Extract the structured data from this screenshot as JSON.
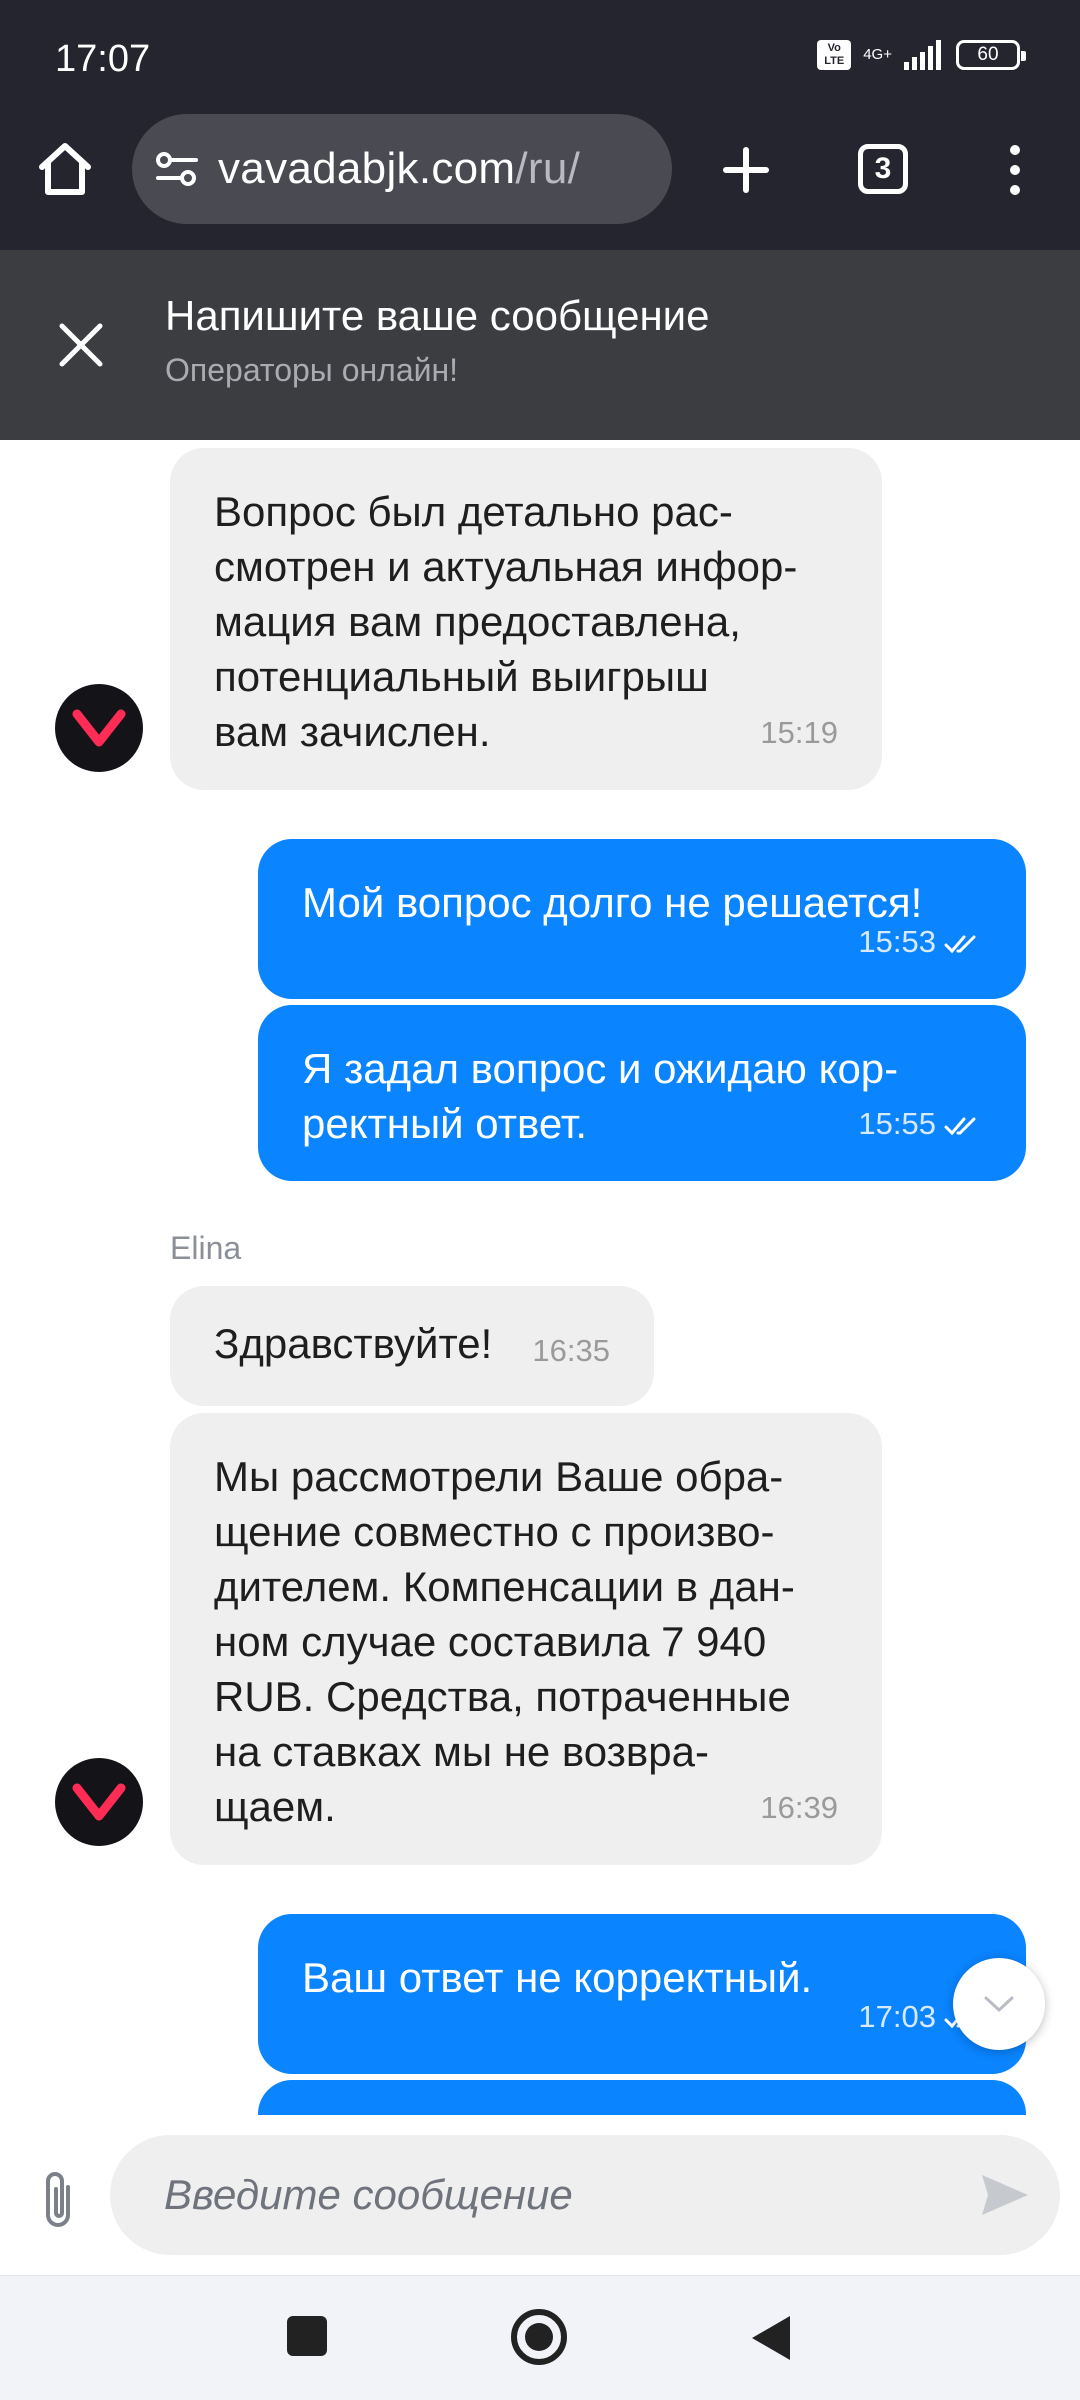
{
  "status_bar": {
    "time": "17:07",
    "volte": "Vo LTE",
    "network": "4G+",
    "battery": "60"
  },
  "browser": {
    "url_domain": "vavadabjk.com",
    "url_path": "/ru/",
    "tab_count": "3"
  },
  "chat_header": {
    "title": "Напишите ваше сообщение",
    "subtitle": "Операторы онлайн!"
  },
  "messages": [
    {
      "dir": "in",
      "text": "Вопрос был детально рас-\nсмотрен и актуальная инфор-\nмация вам предоставлена,\nпотенциальный выигрыш\nвам зачислен.",
      "time": "15:19"
    },
    {
      "dir": "out",
      "text": "Мой вопрос долго не решается!",
      "time": "15:53"
    },
    {
      "dir": "out",
      "text": "Я задал вопрос и ожидаю кор-\nректный ответ.",
      "time": "15:55"
    },
    {
      "dir": "in",
      "sender": "Elina",
      "text": "Здравствуйте!",
      "time": "16:35"
    },
    {
      "dir": "in",
      "text": "Мы рассмотрели Ваше обра-\nщение совместно с произво-\nдителем. Компенсации в дан-\nном случае составила 7 940\nRUB. Средства, потраченные\nна ставках мы не возвра-\nщаем.",
      "time": "16:39"
    },
    {
      "dir": "out",
      "text": "Ваш ответ не корректный.",
      "time": "17:03"
    }
  ],
  "composer": {
    "placeholder": "Введите сообщение"
  },
  "colors": {
    "outgoing": "#0a84ff",
    "incoming": "#efefef",
    "header": "#3b3d41",
    "brand_red": "#ff2d55"
  }
}
